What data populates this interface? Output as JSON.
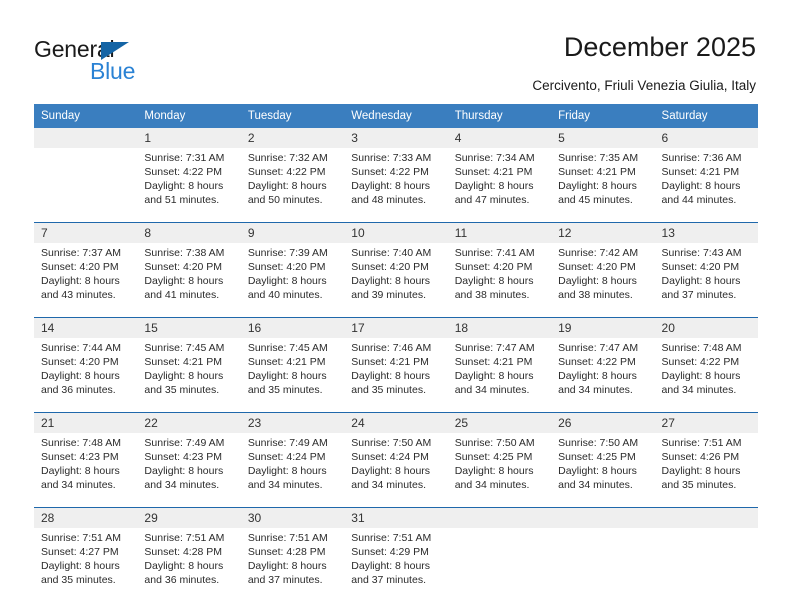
{
  "brand": {
    "name_primary": "General",
    "name_secondary": "Blue"
  },
  "header": {
    "title": "December 2025",
    "subtitle": "Cercivento, Friuli Venezia Giulia, Italy"
  },
  "calendar": {
    "weekday_headers": [
      "Sunday",
      "Monday",
      "Tuesday",
      "Wednesday",
      "Thursday",
      "Friday",
      "Saturday"
    ],
    "accent_header_color": "#3a7ebf",
    "week_separator_color": "#1f68ab",
    "daynum_band_color": "#efefef",
    "weeks": [
      [
        {
          "day": "",
          "lines": []
        },
        {
          "day": "1",
          "lines": [
            "Sunrise: 7:31 AM",
            "Sunset: 4:22 PM",
            "Daylight: 8 hours",
            "and 51 minutes."
          ]
        },
        {
          "day": "2",
          "lines": [
            "Sunrise: 7:32 AM",
            "Sunset: 4:22 PM",
            "Daylight: 8 hours",
            "and 50 minutes."
          ]
        },
        {
          "day": "3",
          "lines": [
            "Sunrise: 7:33 AM",
            "Sunset: 4:22 PM",
            "Daylight: 8 hours",
            "and 48 minutes."
          ]
        },
        {
          "day": "4",
          "lines": [
            "Sunrise: 7:34 AM",
            "Sunset: 4:21 PM",
            "Daylight: 8 hours",
            "and 47 minutes."
          ]
        },
        {
          "day": "5",
          "lines": [
            "Sunrise: 7:35 AM",
            "Sunset: 4:21 PM",
            "Daylight: 8 hours",
            "and 45 minutes."
          ]
        },
        {
          "day": "6",
          "lines": [
            "Sunrise: 7:36 AM",
            "Sunset: 4:21 PM",
            "Daylight: 8 hours",
            "and 44 minutes."
          ]
        }
      ],
      [
        {
          "day": "7",
          "lines": [
            "Sunrise: 7:37 AM",
            "Sunset: 4:20 PM",
            "Daylight: 8 hours",
            "and 43 minutes."
          ]
        },
        {
          "day": "8",
          "lines": [
            "Sunrise: 7:38 AM",
            "Sunset: 4:20 PM",
            "Daylight: 8 hours",
            "and 41 minutes."
          ]
        },
        {
          "day": "9",
          "lines": [
            "Sunrise: 7:39 AM",
            "Sunset: 4:20 PM",
            "Daylight: 8 hours",
            "and 40 minutes."
          ]
        },
        {
          "day": "10",
          "lines": [
            "Sunrise: 7:40 AM",
            "Sunset: 4:20 PM",
            "Daylight: 8 hours",
            "and 39 minutes."
          ]
        },
        {
          "day": "11",
          "lines": [
            "Sunrise: 7:41 AM",
            "Sunset: 4:20 PM",
            "Daylight: 8 hours",
            "and 38 minutes."
          ]
        },
        {
          "day": "12",
          "lines": [
            "Sunrise: 7:42 AM",
            "Sunset: 4:20 PM",
            "Daylight: 8 hours",
            "and 38 minutes."
          ]
        },
        {
          "day": "13",
          "lines": [
            "Sunrise: 7:43 AM",
            "Sunset: 4:20 PM",
            "Daylight: 8 hours",
            "and 37 minutes."
          ]
        }
      ],
      [
        {
          "day": "14",
          "lines": [
            "Sunrise: 7:44 AM",
            "Sunset: 4:20 PM",
            "Daylight: 8 hours",
            "and 36 minutes."
          ]
        },
        {
          "day": "15",
          "lines": [
            "Sunrise: 7:45 AM",
            "Sunset: 4:21 PM",
            "Daylight: 8 hours",
            "and 35 minutes."
          ]
        },
        {
          "day": "16",
          "lines": [
            "Sunrise: 7:45 AM",
            "Sunset: 4:21 PM",
            "Daylight: 8 hours",
            "and 35 minutes."
          ]
        },
        {
          "day": "17",
          "lines": [
            "Sunrise: 7:46 AM",
            "Sunset: 4:21 PM",
            "Daylight: 8 hours",
            "and 35 minutes."
          ]
        },
        {
          "day": "18",
          "lines": [
            "Sunrise: 7:47 AM",
            "Sunset: 4:21 PM",
            "Daylight: 8 hours",
            "and 34 minutes."
          ]
        },
        {
          "day": "19",
          "lines": [
            "Sunrise: 7:47 AM",
            "Sunset: 4:22 PM",
            "Daylight: 8 hours",
            "and 34 minutes."
          ]
        },
        {
          "day": "20",
          "lines": [
            "Sunrise: 7:48 AM",
            "Sunset: 4:22 PM",
            "Daylight: 8 hours",
            "and 34 minutes."
          ]
        }
      ],
      [
        {
          "day": "21",
          "lines": [
            "Sunrise: 7:48 AM",
            "Sunset: 4:23 PM",
            "Daylight: 8 hours",
            "and 34 minutes."
          ]
        },
        {
          "day": "22",
          "lines": [
            "Sunrise: 7:49 AM",
            "Sunset: 4:23 PM",
            "Daylight: 8 hours",
            "and 34 minutes."
          ]
        },
        {
          "day": "23",
          "lines": [
            "Sunrise: 7:49 AM",
            "Sunset: 4:24 PM",
            "Daylight: 8 hours",
            "and 34 minutes."
          ]
        },
        {
          "day": "24",
          "lines": [
            "Sunrise: 7:50 AM",
            "Sunset: 4:24 PM",
            "Daylight: 8 hours",
            "and 34 minutes."
          ]
        },
        {
          "day": "25",
          "lines": [
            "Sunrise: 7:50 AM",
            "Sunset: 4:25 PM",
            "Daylight: 8 hours",
            "and 34 minutes."
          ]
        },
        {
          "day": "26",
          "lines": [
            "Sunrise: 7:50 AM",
            "Sunset: 4:25 PM",
            "Daylight: 8 hours",
            "and 34 minutes."
          ]
        },
        {
          "day": "27",
          "lines": [
            "Sunrise: 7:51 AM",
            "Sunset: 4:26 PM",
            "Daylight: 8 hours",
            "and 35 minutes."
          ]
        }
      ],
      [
        {
          "day": "28",
          "lines": [
            "Sunrise: 7:51 AM",
            "Sunset: 4:27 PM",
            "Daylight: 8 hours",
            "and 35 minutes."
          ]
        },
        {
          "day": "29",
          "lines": [
            "Sunrise: 7:51 AM",
            "Sunset: 4:28 PM",
            "Daylight: 8 hours",
            "and 36 minutes."
          ]
        },
        {
          "day": "30",
          "lines": [
            "Sunrise: 7:51 AM",
            "Sunset: 4:28 PM",
            "Daylight: 8 hours",
            "and 37 minutes."
          ]
        },
        {
          "day": "31",
          "lines": [
            "Sunrise: 7:51 AM",
            "Sunset: 4:29 PM",
            "Daylight: 8 hours",
            "and 37 minutes."
          ]
        },
        {
          "day": "",
          "lines": []
        },
        {
          "day": "",
          "lines": []
        },
        {
          "day": "",
          "lines": []
        }
      ]
    ]
  }
}
